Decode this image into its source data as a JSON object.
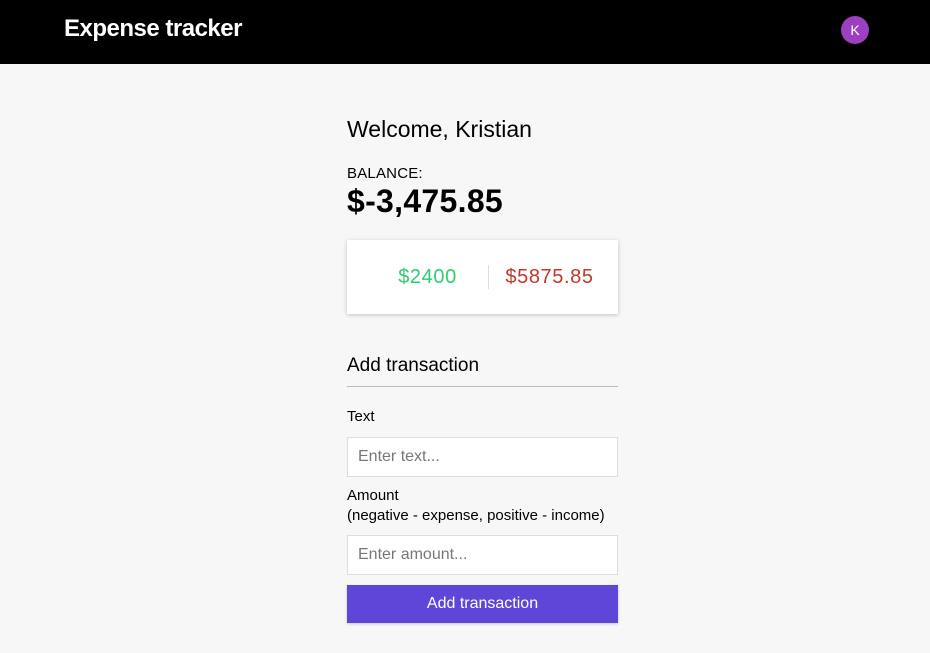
{
  "header": {
    "title": "Expense tracker",
    "avatar_initial": "K",
    "avatar_color": "#9c3fc1"
  },
  "main": {
    "welcome": "Welcome, Kristian",
    "balance_label": "BALANCE:",
    "balance_value": "$-3,475.85",
    "income": "$2400",
    "expense": "$5875.85",
    "income_color": "#2ecc71",
    "expense_color": "#c0392b"
  },
  "form": {
    "heading": "Add transaction",
    "text_label": "Text",
    "text_value": "",
    "text_placeholder": "Enter text...",
    "amount_label_line1": "Amount",
    "amount_label_line2": "(negative - expense, positive - income)",
    "amount_value": "",
    "amount_placeholder": "Enter amount...",
    "submit_label": "Add transaction",
    "submit_color": "#5f46d9"
  }
}
